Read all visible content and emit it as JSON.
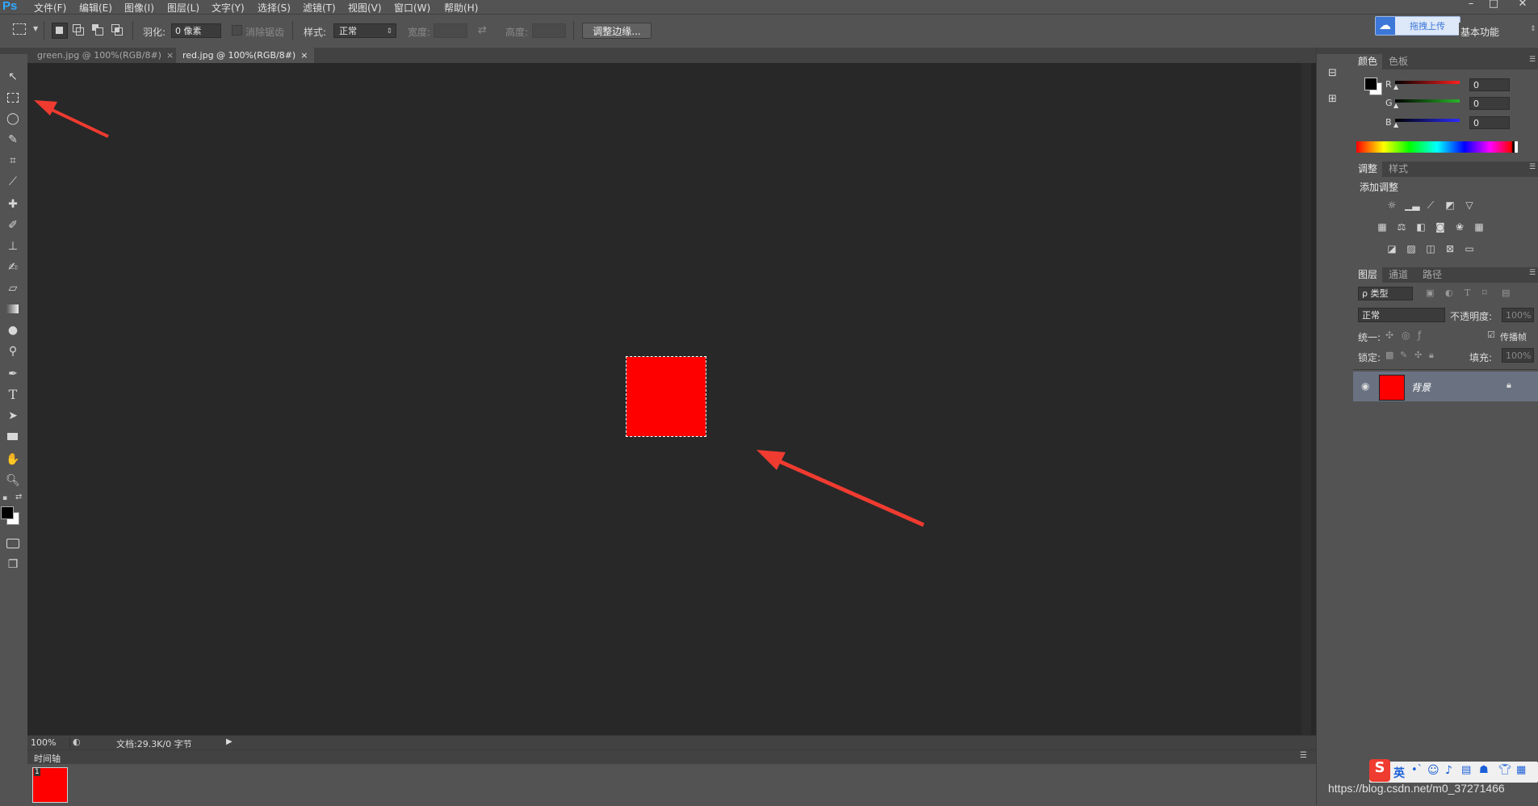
{
  "app": {
    "logo": "Ps"
  },
  "menu": [
    "文件(F)",
    "编辑(E)",
    "图像(I)",
    "图层(L)",
    "文字(Y)",
    "选择(S)",
    "滤镜(T)",
    "视图(V)",
    "窗口(W)",
    "帮助(H)"
  ],
  "window_buttons": [
    "–",
    "□",
    "✕"
  ],
  "cloud_button": {
    "label": "拖拽上传"
  },
  "workspace": {
    "label": "基本功能"
  },
  "options": {
    "feather_label": "羽化:",
    "feather_value": "0 像素",
    "antialias_label": "消除锯齿",
    "style_label": "样式:",
    "style_value": "正常",
    "width_label": "宽度:",
    "height_label": "高度:",
    "refine_edge_button": "调整边缘..."
  },
  "tabs": [
    {
      "label": "green.jpg @ 100%(RGB/8#)",
      "close": "×",
      "active": false
    },
    {
      "label": "red.jpg @ 100%(RGB/8#)",
      "close": "×",
      "active": true
    }
  ],
  "document": {
    "fill_color": "#ff0000",
    "canvas_color": "#282828"
  },
  "status": {
    "zoom": "100%",
    "doc_info": "文档:29.3K/0 字节"
  },
  "timeline": {
    "title": "时间轴",
    "frame_number": "1"
  },
  "color_panel": {
    "tabs": [
      "颜色",
      "色板"
    ],
    "channels": [
      {
        "name": "R",
        "value": "0",
        "color": "#ff1e1e"
      },
      {
        "name": "G",
        "value": "0",
        "color": "#2ab52a"
      },
      {
        "name": "B",
        "value": "0",
        "color": "#2b2bff"
      }
    ]
  },
  "adjust_panel": {
    "tabs": [
      "调整",
      "样式"
    ],
    "title": "添加调整"
  },
  "layers_panel": {
    "tabs": [
      "图层",
      "通道",
      "路径"
    ],
    "filter_label": "ρ 类型",
    "blend_mode": "正常",
    "opacity_label": "不透明度:",
    "opacity_value": "100%",
    "unify_label": "统一:",
    "propagate_label": "传播帧",
    "lock_label": "锁定:",
    "fill_label": "填充:",
    "fill_value": "100%",
    "layers": [
      {
        "name": "背景",
        "thumb_color": "#ff0000"
      }
    ]
  },
  "ime_bar": {
    "logo": "S",
    "lang": "英"
  },
  "watermark": "https://blog.csdn.net/m0_37271466",
  "annotation_color": "#ef3b30"
}
